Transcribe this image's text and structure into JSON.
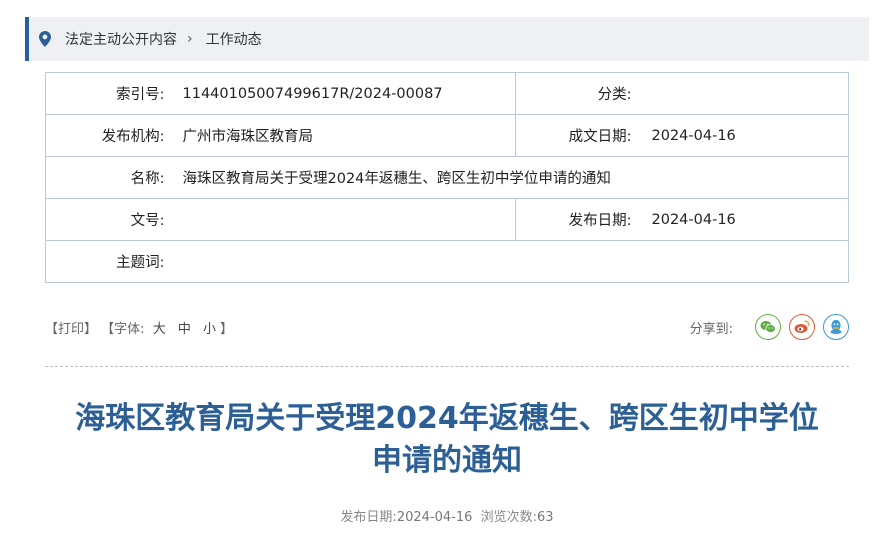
{
  "breadcrumb": {
    "items": [
      "法定主动公开内容",
      "工作动态"
    ],
    "separator": "›"
  },
  "meta": {
    "index_label": "索引号:",
    "index_value": "11440105007499617R/2024-00087",
    "category_label": "分类:",
    "category_value": "",
    "publisher_label": "发布机构:",
    "publisher_value": "广州市海珠区教育局",
    "created_label": "成文日期:",
    "created_value": "2024-04-16",
    "name_label": "名称:",
    "name_value": "海珠区教育局关于受理2024年返穗生、跨区生初中学位申请的通知",
    "docno_label": "文号:",
    "docno_value": "",
    "pubdate_label": "发布日期:",
    "pubdate_value": "2024-04-16",
    "subject_label": "主题词:",
    "subject_value": ""
  },
  "toolbar": {
    "print": "【打印】",
    "font_prefix": "【字体:",
    "font_large": "大",
    "font_medium": "中",
    "font_small": "小",
    "font_suffix": "】",
    "share_label": "分享到:"
  },
  "article": {
    "title_line1": "海珠区教育局关于受理2024年返穗生、跨区生初中学位",
    "title_line2": "申请的通知",
    "pub_label": "发布日期:",
    "pub_value": "2024-04-16",
    "views_label": "浏览次数:",
    "views_value": "63"
  },
  "colors": {
    "accent": "#2c5f96",
    "wechat": "#5fb040",
    "weibo": "#e05a3a",
    "qq": "#3b9ad9"
  }
}
